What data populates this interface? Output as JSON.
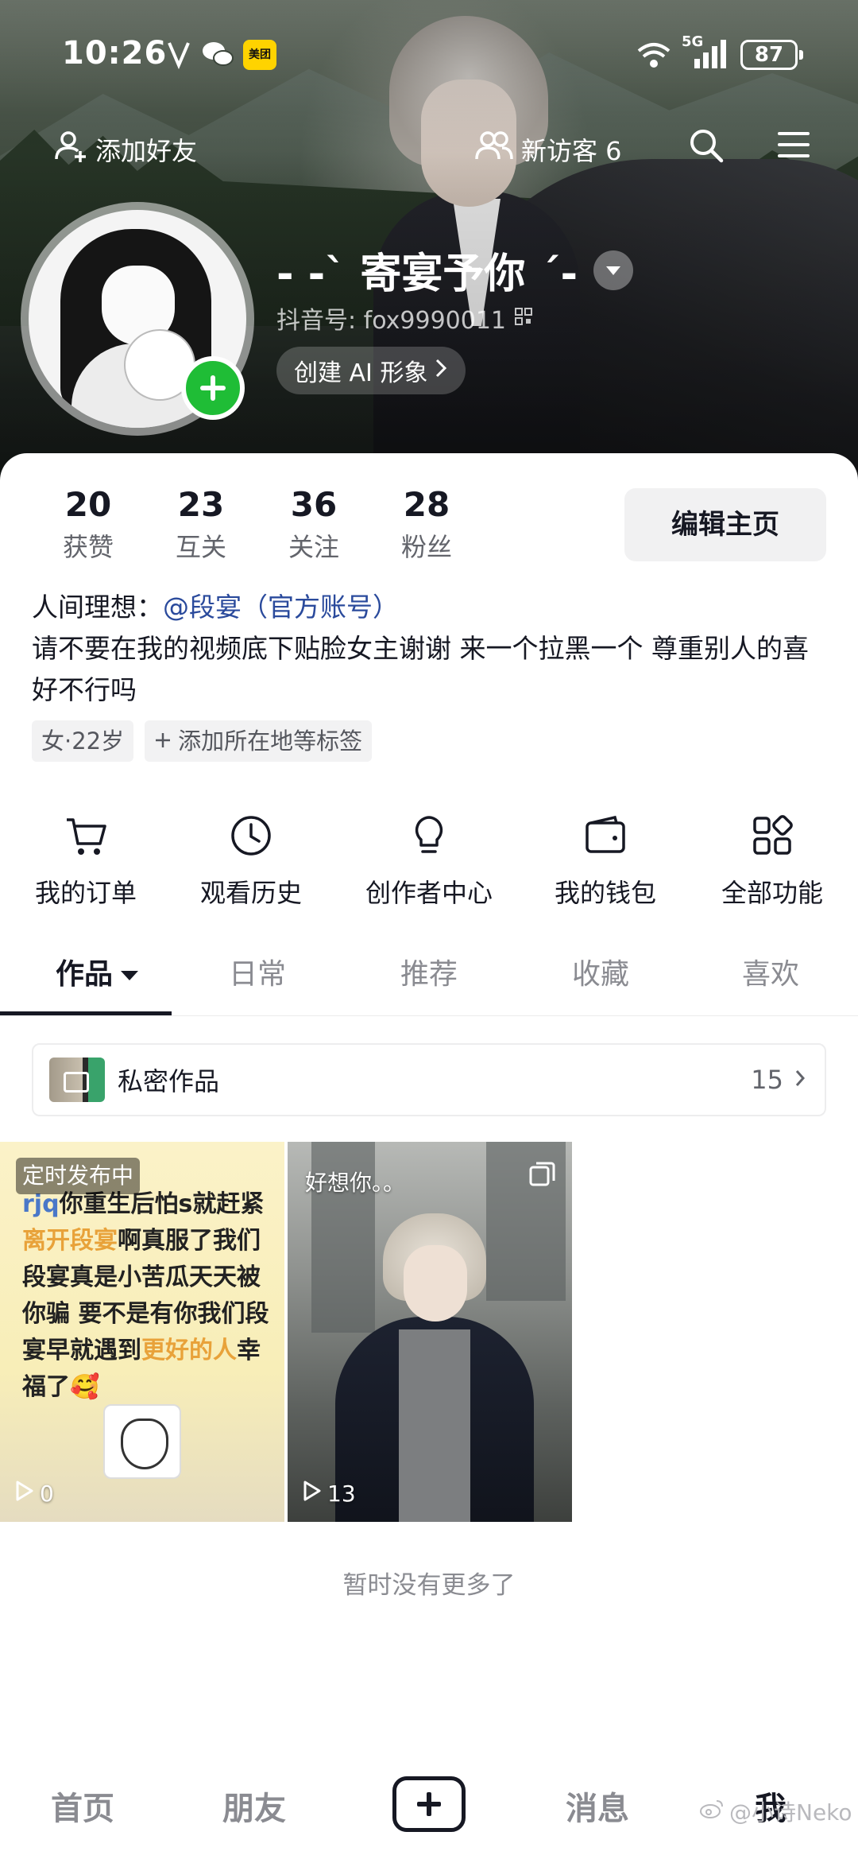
{
  "status_bar": {
    "time": "10:26",
    "network": "5G",
    "battery": "87",
    "app_badge": "美团"
  },
  "top_nav": {
    "add_friend": "添加好友",
    "new_visitors": "新访客 6"
  },
  "profile": {
    "nickname": "- -` 寄宴予你 ´-",
    "douyin_id": "抖音号: fox9990011",
    "ai_chip": "创建 AI 形象"
  },
  "stats": [
    {
      "num": "20",
      "label": "获赞"
    },
    {
      "num": "23",
      "label": "互关"
    },
    {
      "num": "36",
      "label": "关注"
    },
    {
      "num": "28",
      "label": "粉丝"
    }
  ],
  "edit_profile": "编辑主页",
  "bio": {
    "line1_prefix": "人间理想：",
    "mention": "@段宴（官方账号）",
    "line2": "请不要在我的视频底下贴脸女主谢谢 来一个拉黑一个 尊重别人的喜好不行吗"
  },
  "tags": [
    "女·22岁",
    "添加所在地等标签"
  ],
  "shortcuts": [
    {
      "icon": "cart-icon",
      "label": "我的订单"
    },
    {
      "icon": "clock-icon",
      "label": "观看历史"
    },
    {
      "icon": "bulb-icon",
      "label": "创作者中心"
    },
    {
      "icon": "wallet-icon",
      "label": "我的钱包"
    },
    {
      "icon": "grid-icon",
      "label": "全部功能"
    }
  ],
  "tabs": [
    "作品",
    "日常",
    "推荐",
    "收藏",
    "喜欢"
  ],
  "private_works": {
    "title": "私密作品",
    "count": "15"
  },
  "videos": [
    {
      "badge": "定时发布中",
      "text_parts": [
        "rjq",
        "你重生后怕s就赶紧",
        "离开段宴",
        "啊真服了我们段宴真是小苦瓜天天被你骗 要不是有你我们段宴早就遇到",
        "更好的人",
        "幸福了🥰"
      ],
      "plays": "0"
    },
    {
      "caption": "好想你。。",
      "plays": "13"
    }
  ],
  "no_more": "暂时没有更多了",
  "bottom_nav": [
    "首页",
    "朋友",
    "消息",
    "我"
  ],
  "watermark": "@小诗Neko",
  "colors": {
    "accent_green": "#1fbd36",
    "mention_blue": "#2a4a9c",
    "text_primary": "#161823",
    "text_secondary": "#8a8b91"
  }
}
